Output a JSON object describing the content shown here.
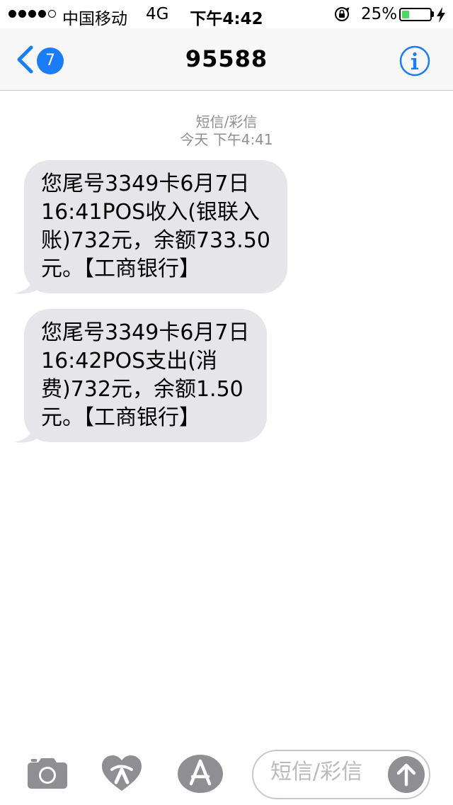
{
  "status_bar": {
    "carrier": "中国移动",
    "network": "4G",
    "time": "下午4:42",
    "battery_percent": "25%",
    "battery_level": 0.25
  },
  "nav": {
    "back_badge": "7",
    "title": "95588"
  },
  "conversation": {
    "message_type": "短信/彩信",
    "timestamp": "今天 下午4:41",
    "messages": [
      {
        "text": "您尾号3349卡6月7日\n16:41POS收入(银联入\n账)732元，余额733.50\n元。【工商银行】"
      },
      {
        "text": "您尾号3349卡6月7日\n16:42POS支出(消\n费)732元，余额1.50\n元。【工商银行】"
      }
    ]
  },
  "toolbar": {
    "compose_placeholder": "短信/彩信"
  },
  "colors": {
    "accent": "#1a7cf6",
    "bubble": "#e5e5ea",
    "battery": "#4cd964",
    "icon_gray": "#8e8e93"
  }
}
